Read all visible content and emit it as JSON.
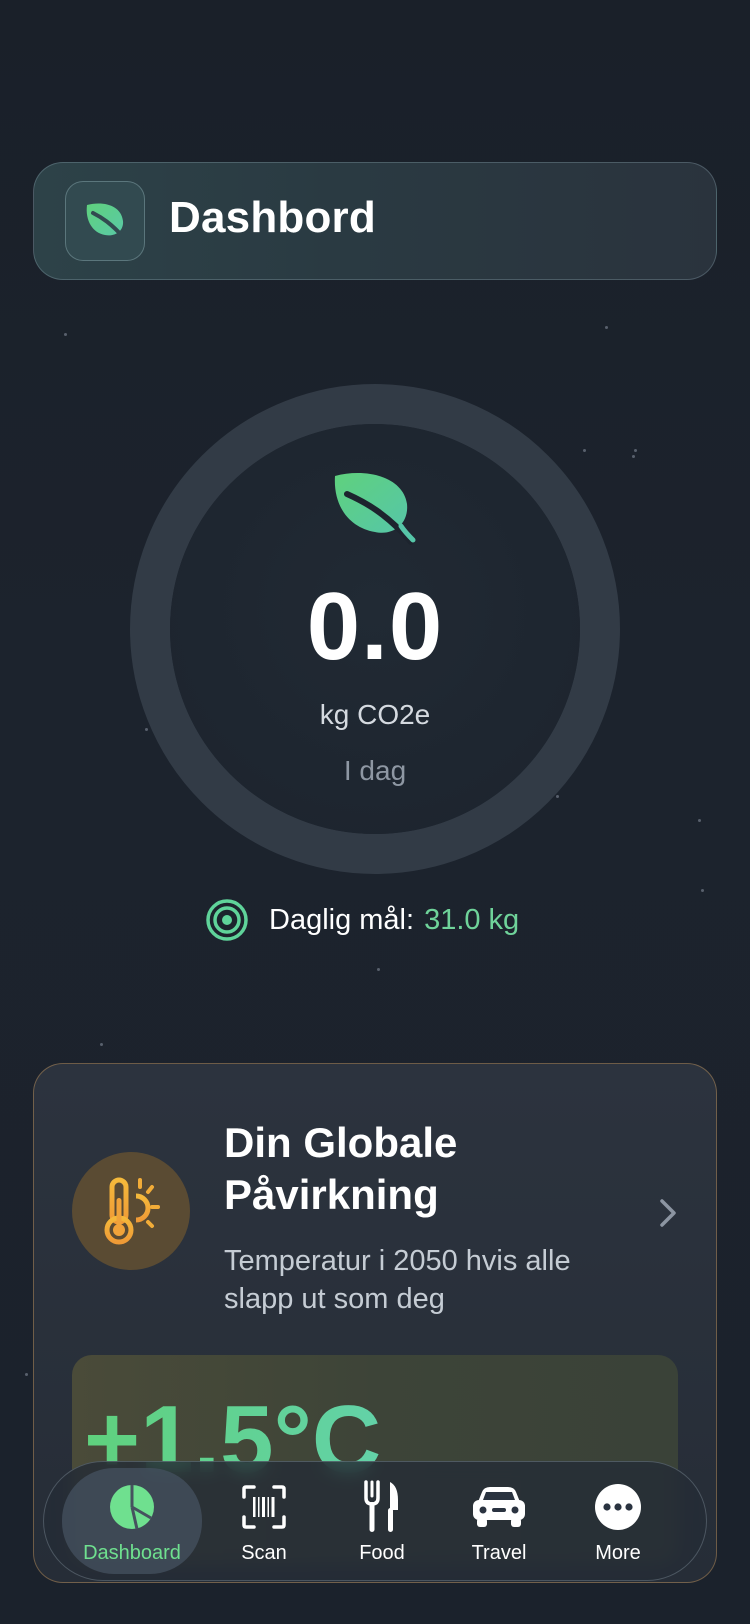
{
  "header": {
    "title": "Dashbord"
  },
  "emissions": {
    "value": "0.0",
    "unit": "kg CO2e",
    "period": "I dag"
  },
  "goal": {
    "label": "Daglig mål:",
    "value": "31.0 kg"
  },
  "impact_card": {
    "title": "Din Globale Påvirkning",
    "subtitle": "Temperatur i 2050 hvis alle slapp ut som deg",
    "temperature": "+1.5°C"
  },
  "tabbar": {
    "items": [
      {
        "label": "Dashboard",
        "icon": "pie-chart-icon",
        "active": true
      },
      {
        "label": "Scan",
        "icon": "barcode-scan-icon",
        "active": false
      },
      {
        "label": "Food",
        "icon": "fork-knife-icon",
        "active": false
      },
      {
        "label": "Travel",
        "icon": "car-icon",
        "active": false
      },
      {
        "label": "More",
        "icon": "more-dots-icon",
        "active": false
      }
    ]
  },
  "colors": {
    "accent_green": "#6fd39a",
    "active_tab_green": "#6fe08f",
    "warning_orange": "#f0a33a"
  }
}
